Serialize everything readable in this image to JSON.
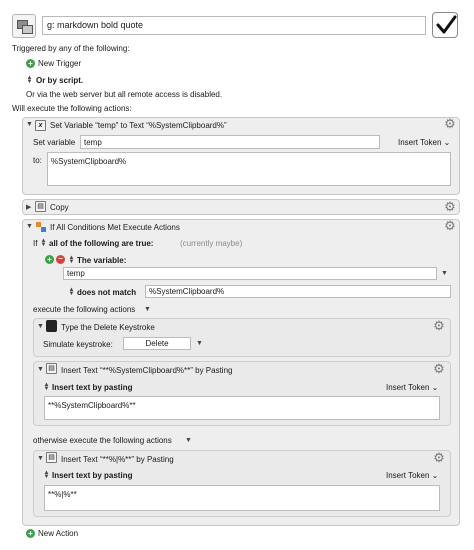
{
  "macro": {
    "name": "g: markdown bold quote",
    "enabled": true
  },
  "triggers": {
    "heading": "Triggered by any of the following:",
    "new_trigger": "New Trigger",
    "or_by_script": "Or by script.",
    "web_server_note": "Or via the web server but all remote access is disabled."
  },
  "actions_heading": "Will execute the following actions:",
  "set_variable": {
    "title": "Set Variable “temp” to Text “%SystemClipboard%”",
    "set_variable_label": "Set variable",
    "variable_value": "temp",
    "insert_token": "Insert Token",
    "to_label": "to:",
    "to_value": "%SystemClipboard%"
  },
  "copy": {
    "title": "Copy"
  },
  "if_block": {
    "title": "If All Conditions Met Execute Actions",
    "if_label": "If",
    "all_label": "all of the following are true:",
    "currently": "(currently maybe)",
    "condition_type": "The variable:",
    "condition_var": "temp",
    "operator": "does not match",
    "operand": "%SystemClipboard%",
    "execute_label": "execute the following actions",
    "otherwise_label": "otherwise execute the following actions"
  },
  "keystroke": {
    "title": "Type the Delete Keystroke",
    "simulate_label": "Simulate keystroke:",
    "key": "Delete"
  },
  "insert1": {
    "title": "Insert Text “**%SystemClipboard%**” by Pasting",
    "mode": "Insert text by pasting",
    "insert_token": "Insert Token",
    "text": "**%SystemClipboard%**"
  },
  "insert2": {
    "title": "Insert Text “**%|%**” by Pasting",
    "mode": "Insert text by pasting",
    "insert_token": "Insert Token",
    "text": "**%|%**"
  },
  "new_action": "New Action",
  "colors": {
    "add": "#3ea04a",
    "remove": "#d84040",
    "panel": "#eeeeee"
  }
}
